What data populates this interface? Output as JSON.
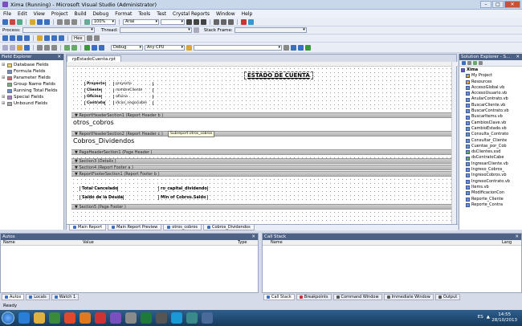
{
  "window": {
    "title": "Xima (Running) - Microsoft Visual Studio (Administrator)",
    "min": "–",
    "max": "□",
    "close": "✕"
  },
  "menu": [
    "File",
    "Edit",
    "View",
    "Project",
    "Build",
    "Debug",
    "Format",
    "Tools",
    "Test",
    "Crystal Reports",
    "Window",
    "Help"
  ],
  "toolbar1": {
    "zoom": "100%",
    "font": "Arial",
    "size": ""
  },
  "toolbar2": {
    "process_label": "Process:",
    "thread_label": "Thread:",
    "stack_label": "Stack Frame:"
  },
  "toolbar3": {
    "hex": "Hex"
  },
  "toolbar4": {
    "config": "Debug",
    "platform": "Any CPU"
  },
  "field_explorer": {
    "title": "Field Explorer",
    "items": [
      "Database Fields",
      "Formula Fields",
      "Parameter Fields",
      "Group Name Fields",
      "Running Total Fields",
      "Special Fields",
      "Unbound Fields"
    ]
  },
  "document": {
    "tab": "rpEstadoCuenta.rpt",
    "report_title": "ESTADO DE CUENTA",
    "labels": [
      "Proyecto",
      "Cliente",
      "Oficina",
      "Contrato"
    ],
    "fields": [
      "proyecto",
      "nombreCliente",
      "oficina",
      "idcon_negociable"
    ],
    "sections": [
      "ReportHeaderSection1 (Report Header b )",
      "ReportHeaderSection2 (Report Header c )",
      "PageHeaderSection1 (Page Header )",
      "Section3 (Details )",
      "Section4 (Report Footer a )",
      "ReportFooterSection1 (Report Footer b )",
      "Section5 (Page Footer )"
    ],
    "subreport1": "otros_cobros",
    "subreport_tooltip": "Subreport:otros_cobros",
    "subreport2": "Cobros_Dividendos",
    "footer_labels": [
      "Total Cancelado",
      "Saldo de la Deuda"
    ],
    "footer_fields": [
      "ro_capital_dividendo",
      "Min of Cobros.Saldo"
    ],
    "bottom_tabs": [
      "Main Report",
      "Main Report Preview",
      "otros_cobros",
      "Cobros_Dividendos"
    ]
  },
  "solution_explorer": {
    "title": "Solution Explorer - S...",
    "items": [
      "Xima",
      "My Project",
      "Resources",
      "AccesoGlobal.vb",
      "AccesoUsuario.vb",
      "AnularContrato.vb",
      "BuscarCliente.vb",
      "BuscarContrato.vb",
      "BuscarItems.vb",
      "CambiosClave.vb",
      "CambioEstado.vb",
      "Consulta_Contrato",
      "Consultar_Cliente",
      "Cuentas_por_Cob",
      "dsClientes.xsd",
      "dsContratoCabe",
      "IngresarCliente.vb",
      "Ingreso_Cobros_",
      "IngresoCobros.vb",
      "IngresoContrato.vb",
      "Items.vb",
      "ModificacionCon",
      "Reporte_Cliente",
      "Reporte_Contra"
    ]
  },
  "autos": {
    "title": "Autos",
    "cols": [
      "Name",
      "Value",
      "Type"
    ]
  },
  "callstack": {
    "title": "Call Stack",
    "cols": [
      "Name",
      "Lang"
    ]
  },
  "low_tabs_left": [
    "Autos",
    "Locals",
    "Watch 1"
  ],
  "low_tabs_right": [
    "Call Stack",
    "Breakpoints",
    "Command Window",
    "Immediate Window",
    "Output"
  ],
  "status": "Ready",
  "taskbar": {
    "lang": "ES",
    "time": "14:55",
    "date": "28/10/2013"
  }
}
